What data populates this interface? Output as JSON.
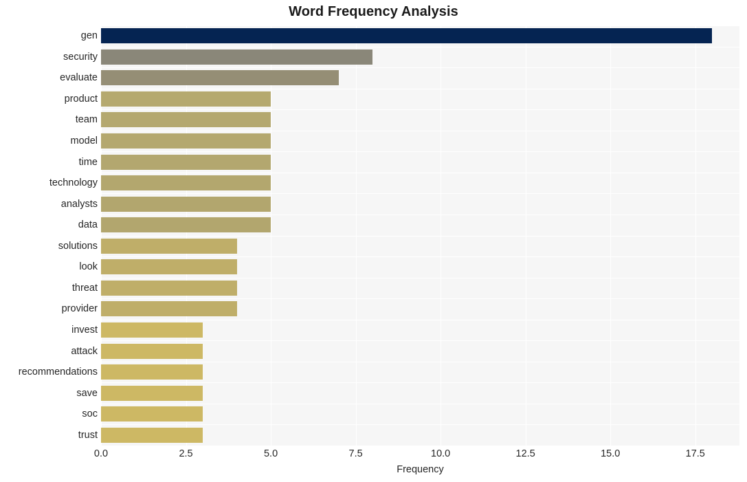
{
  "chart_data": {
    "type": "bar",
    "orientation": "horizontal",
    "title": "Word Frequency Analysis",
    "xlabel": "Frequency",
    "ylabel": "",
    "categories": [
      "gen",
      "security",
      "evaluate",
      "product",
      "team",
      "model",
      "time",
      "technology",
      "analysts",
      "data",
      "solutions",
      "look",
      "threat",
      "provider",
      "invest",
      "attack",
      "recommendations",
      "save",
      "soc",
      "trust"
    ],
    "values": [
      18,
      8,
      7,
      5,
      5,
      5,
      5,
      5,
      5,
      5,
      4,
      4,
      4,
      4,
      3,
      3,
      3,
      3,
      3,
      3
    ],
    "bar_colors": [
      "#052452",
      "#8a8779",
      "#958e75",
      "#b5a96f",
      "#b4a86f",
      "#b4a86f",
      "#b3a76f",
      "#b3a76e",
      "#b2a66e",
      "#b2a66e",
      "#bfae69",
      "#bfae69",
      "#bfae69",
      "#bfae69",
      "#cdb864",
      "#cdb864",
      "#cdb864",
      "#cdb864",
      "#cdb864",
      "#cdb864"
    ],
    "xlim": [
      0,
      18.8
    ],
    "xticks": [
      "0.0",
      "2.5",
      "5.0",
      "7.5",
      "10.0",
      "12.5",
      "15.0",
      "17.5"
    ],
    "xtick_values": [
      0,
      2.5,
      5,
      7.5,
      10,
      12.5,
      15,
      17.5
    ],
    "grid": true,
    "grid_color": "#ffffff",
    "plot_background": "#f6f6f6",
    "figure_background": "#ffffff",
    "legend": null
  }
}
